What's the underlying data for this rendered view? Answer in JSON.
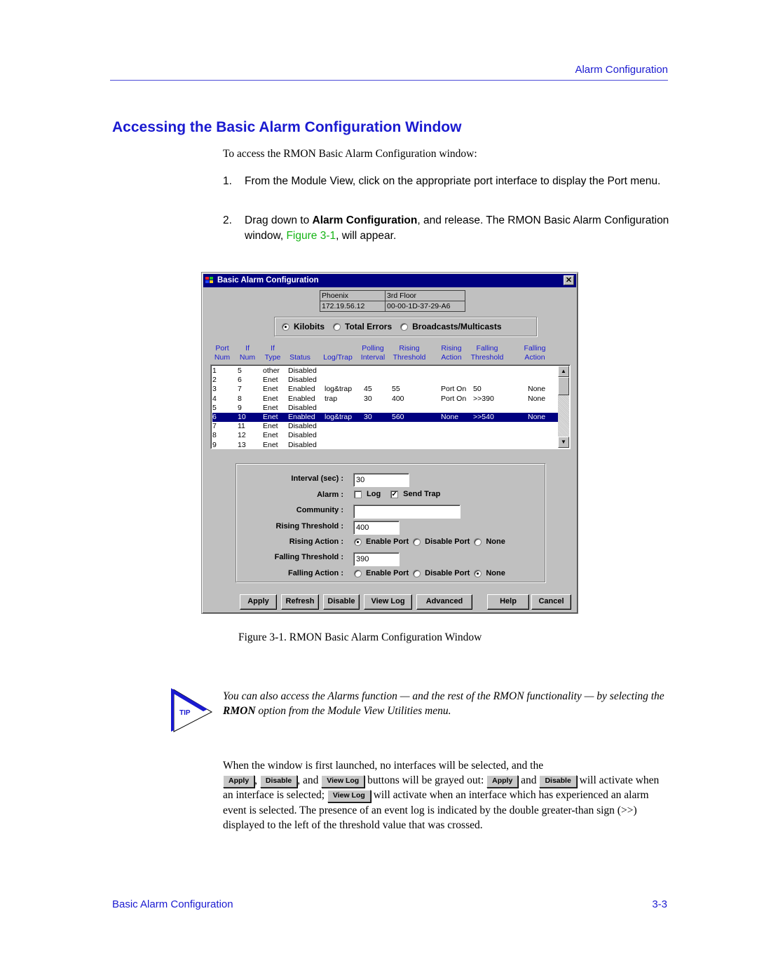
{
  "header": {
    "running_title": "Alarm Configuration"
  },
  "section_title": "Accessing the Basic Alarm Configuration Window",
  "intro": "To access the RMON Basic Alarm Configuration window:",
  "steps": [
    {
      "num": "1.",
      "text": "From the Module View, click on the appropriate port interface to display the Port menu."
    },
    {
      "num": "2.",
      "text_before": "Drag down to ",
      "bold": "Alarm Configuration",
      "text_mid": ", and release. The RMON Basic Alarm Configuration window, ",
      "link": "Figure 3-1",
      "text_after": ", will appear."
    }
  ],
  "window": {
    "title": "Basic Alarm Configuration",
    "close_glyph": "✕",
    "info": {
      "device_name": "Phoenix",
      "location": "3rd Floor",
      "ip": "172.19.56.12",
      "mac": "00-00-1D-37-29-A6"
    },
    "metrics": [
      {
        "label": "Kilobits",
        "selected": true
      },
      {
        "label": "Total Errors",
        "selected": false
      },
      {
        "label": "Broadcasts/Multicasts",
        "selected": false
      }
    ],
    "columns": [
      {
        "line1": "Port",
        "line2": "Num"
      },
      {
        "line1": "If",
        "line2": "Num"
      },
      {
        "line1": "If",
        "line2": "Type"
      },
      {
        "line1": "",
        "line2": "Status"
      },
      {
        "line1": "",
        "line2": "Log/Trap"
      },
      {
        "line1": "Polling",
        "line2": "Interval"
      },
      {
        "line1": "Rising",
        "line2": "Threshold"
      },
      {
        "line1": "Rising",
        "line2": "Action"
      },
      {
        "line1": "Falling",
        "line2": "Threshold"
      },
      {
        "line1": "Falling",
        "line2": "Action"
      }
    ],
    "rows": [
      [
        "1",
        "5",
        "other",
        "Disabled",
        "",
        "",
        "",
        "",
        "",
        ""
      ],
      [
        "2",
        "6",
        "Enet",
        "Disabled",
        "",
        "",
        "",
        "",
        "",
        ""
      ],
      [
        "3",
        "7",
        "Enet",
        "Enabled",
        "log&trap",
        "45",
        "55",
        "Port On",
        "50",
        "None"
      ],
      [
        "4",
        "8",
        "Enet",
        "Enabled",
        "trap",
        "30",
        "400",
        "Port On",
        ">>390",
        "None"
      ],
      [
        "5",
        "9",
        "Enet",
        "Disabled",
        "",
        "",
        "",
        "",
        "",
        ""
      ],
      [
        "6",
        "10",
        "Enet",
        "Enabled",
        "log&trap",
        "30",
        "560",
        "None",
        ">>540",
        "None"
      ],
      [
        "7",
        "11",
        "Enet",
        "Disabled",
        "",
        "",
        "",
        "",
        "",
        ""
      ],
      [
        "8",
        "12",
        "Enet",
        "Disabled",
        "",
        "",
        "",
        "",
        "",
        ""
      ],
      [
        "9",
        "13",
        "Enet",
        "Disabled",
        "",
        "",
        "",
        "",
        "",
        ""
      ]
    ],
    "selected_row": 5,
    "settings": {
      "interval_label": "Interval (sec) :",
      "interval_value": "30",
      "alarm_label": "Alarm :",
      "log_label": "Log",
      "log_checked": false,
      "trap_label": "Send Trap",
      "trap_checked": true,
      "community_label": "Community :",
      "community_value": "",
      "rising_threshold_label": "Rising Threshold :",
      "rising_threshold_value": "400",
      "rising_action_label": "Rising Action :",
      "falling_threshold_label": "Falling Threshold :",
      "falling_threshold_value": "390",
      "falling_action_label": "Falling Action :",
      "action_options": [
        "Enable Port",
        "Disable Port",
        "None"
      ],
      "rising_action_selected": "Enable Port",
      "falling_action_selected": "None"
    },
    "buttons": {
      "apply": "Apply",
      "refresh": "Refresh",
      "disable": "Disable",
      "view_log": "View Log",
      "advanced": "Advanced",
      "help": "Help",
      "cancel": "Cancel"
    },
    "check_glyph": "✓",
    "scroll_up_glyph": "▲",
    "scroll_down_glyph": "▼"
  },
  "caption": "Figure 3-1.  RMON Basic Alarm Configuration Window",
  "tip": {
    "icon_label": "TIP",
    "text_before": "You can also access the Alarms function — and the rest of the RMON functionality — by selecting the ",
    "bold": "RMON",
    "text_after": " option from the Module View Utilities menu."
  },
  "paragraph": {
    "p1": "When the window is first launched, no interfaces will be selected, and the",
    "btn_apply": "Apply",
    "sep1": ",",
    "btn_disable": "Disable",
    "sep2": ", and",
    "btn_viewlog": "View Log",
    "p2": "buttons will be grayed out:",
    "p3": "and",
    "p4": "will activate when an interface is selected;",
    "p5": "will activate when an interface which has experienced an alarm event is selected. The presence of an event log is indicated by the double greater-than sign (>>) displayed to the left of the threshold value that was crossed."
  },
  "footer": {
    "left": "Basic Alarm Configuration",
    "page": "3-3"
  },
  "colors": {
    "heading_blue": "#1a1ad0",
    "link_green": "#14b414",
    "titlebar": "#000080",
    "window_gray": "#c0c0c0"
  }
}
